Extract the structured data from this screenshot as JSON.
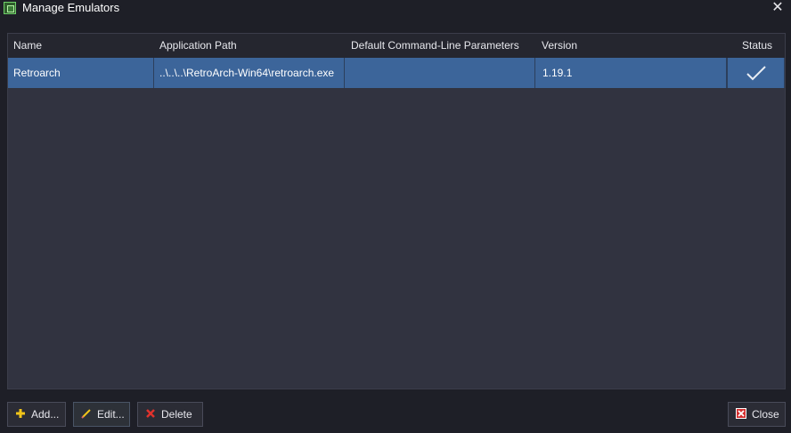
{
  "window": {
    "title": "Manage Emulators",
    "icons": {
      "app": "emulator-app-icon",
      "close": "close-icon"
    }
  },
  "table": {
    "columns": [
      "Name",
      "Application Path",
      "Default Command-Line Parameters",
      "Version",
      "Status"
    ],
    "rows": [
      {
        "name": "Retroarch",
        "path": "..\\..\\..\\RetroArch-Win64\\retroarch.exe",
        "params": "",
        "version": "1.19.1",
        "status_icon": "checkmark-icon"
      }
    ]
  },
  "buttons": {
    "add": {
      "label": "Add...",
      "icon": "plus-icon"
    },
    "edit": {
      "label": "Edit...",
      "icon": "pencil-icon"
    },
    "delete": {
      "label": "Delete",
      "icon": "delete-x-icon"
    },
    "close": {
      "label": "Close",
      "icon": "close-box-icon"
    }
  },
  "colors": {
    "background": "#1e1f27",
    "grid": "#313340",
    "header": "#25262f",
    "selected_row": "#3c659a"
  }
}
